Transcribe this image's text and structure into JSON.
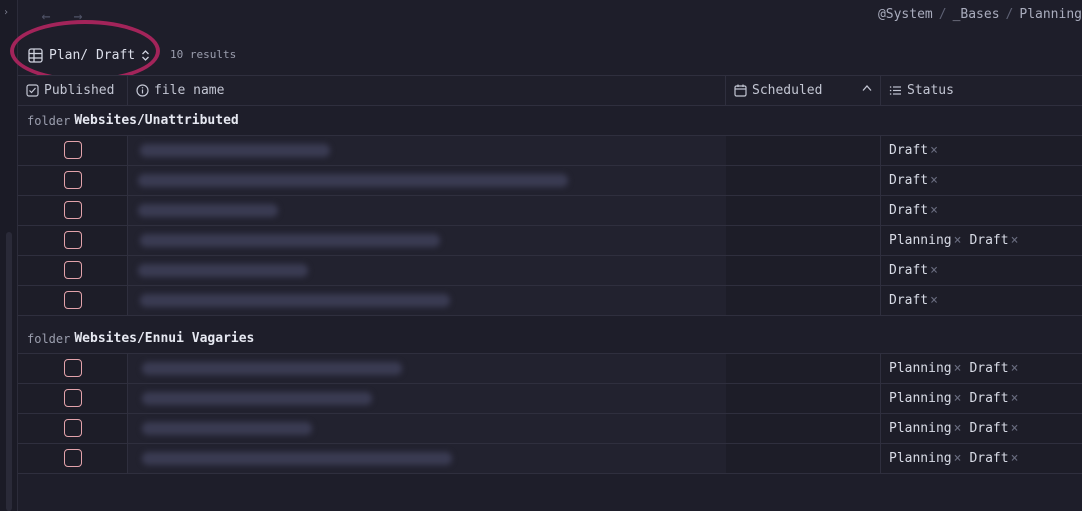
{
  "nav": {
    "back_icon": "arrow-left-icon",
    "forward_icon": "arrow-right-icon"
  },
  "breadcrumb": [
    "@System",
    "_Bases",
    "Planning"
  ],
  "view": {
    "label": "Plan/ Draft",
    "icon": "table-icon",
    "results": "10 results"
  },
  "columns": {
    "published": "Published",
    "file_name": "file name",
    "scheduled": "Scheduled",
    "status": "Status"
  },
  "groups": [
    {
      "keyword": "folder",
      "name": "Websites/Unattributed",
      "rows": [
        {
          "published": false,
          "status": [
            "Draft"
          ]
        },
        {
          "published": false,
          "status": [
            "Draft"
          ]
        },
        {
          "published": false,
          "status": [
            "Draft"
          ]
        },
        {
          "published": false,
          "status": [
            "Planning",
            "Draft"
          ]
        },
        {
          "published": false,
          "status": [
            "Draft"
          ]
        },
        {
          "published": false,
          "status": [
            "Draft"
          ]
        }
      ]
    },
    {
      "keyword": "folder",
      "name": "Websites/Ennui Vagaries",
      "rows": [
        {
          "published": false,
          "status": [
            "Planning",
            "Draft"
          ]
        },
        {
          "published": false,
          "status": [
            "Planning",
            "Draft"
          ]
        },
        {
          "published": false,
          "status": [
            "Planning",
            "Draft"
          ]
        },
        {
          "published": false,
          "status": [
            "Planning",
            "Draft"
          ]
        }
      ]
    }
  ],
  "colors": {
    "accent_ring": "#a3245a",
    "checkbox_border": "#e3a3ab"
  }
}
